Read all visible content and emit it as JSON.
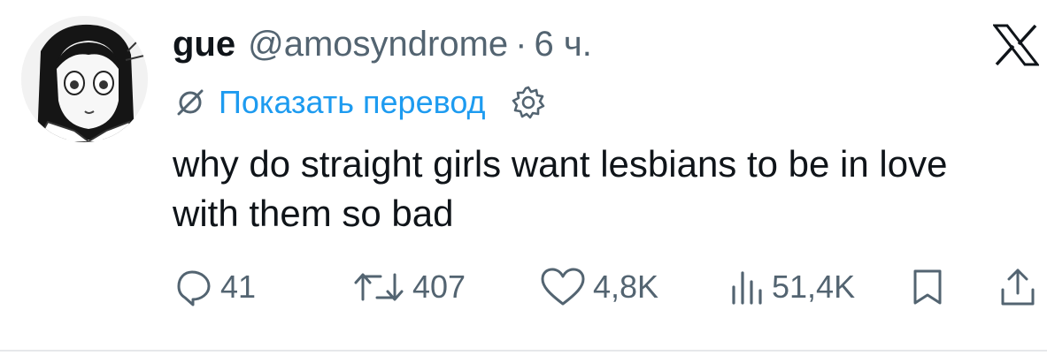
{
  "tweet": {
    "display_name": "gue",
    "handle": "@amosyndrome",
    "separator": "·",
    "time": "6 ч.",
    "translate_label": "Показать перевод",
    "text": "why do straight girls want lesbians to be in love with them so bad"
  },
  "actions": {
    "replies": "41",
    "retweets": "407",
    "likes": "4,8K",
    "views": "51,4K"
  },
  "icons": {
    "logo": "x-logo-icon",
    "translate": "translate-icon",
    "settings": "gear-icon",
    "reply": "reply-icon",
    "retweet": "retweet-icon",
    "like": "heart-icon",
    "views": "views-icon",
    "bookmark": "bookmark-icon",
    "share": "share-icon"
  },
  "colors": {
    "text": "#0f1419",
    "secondary": "#536471",
    "link": "#1d9bf0"
  }
}
